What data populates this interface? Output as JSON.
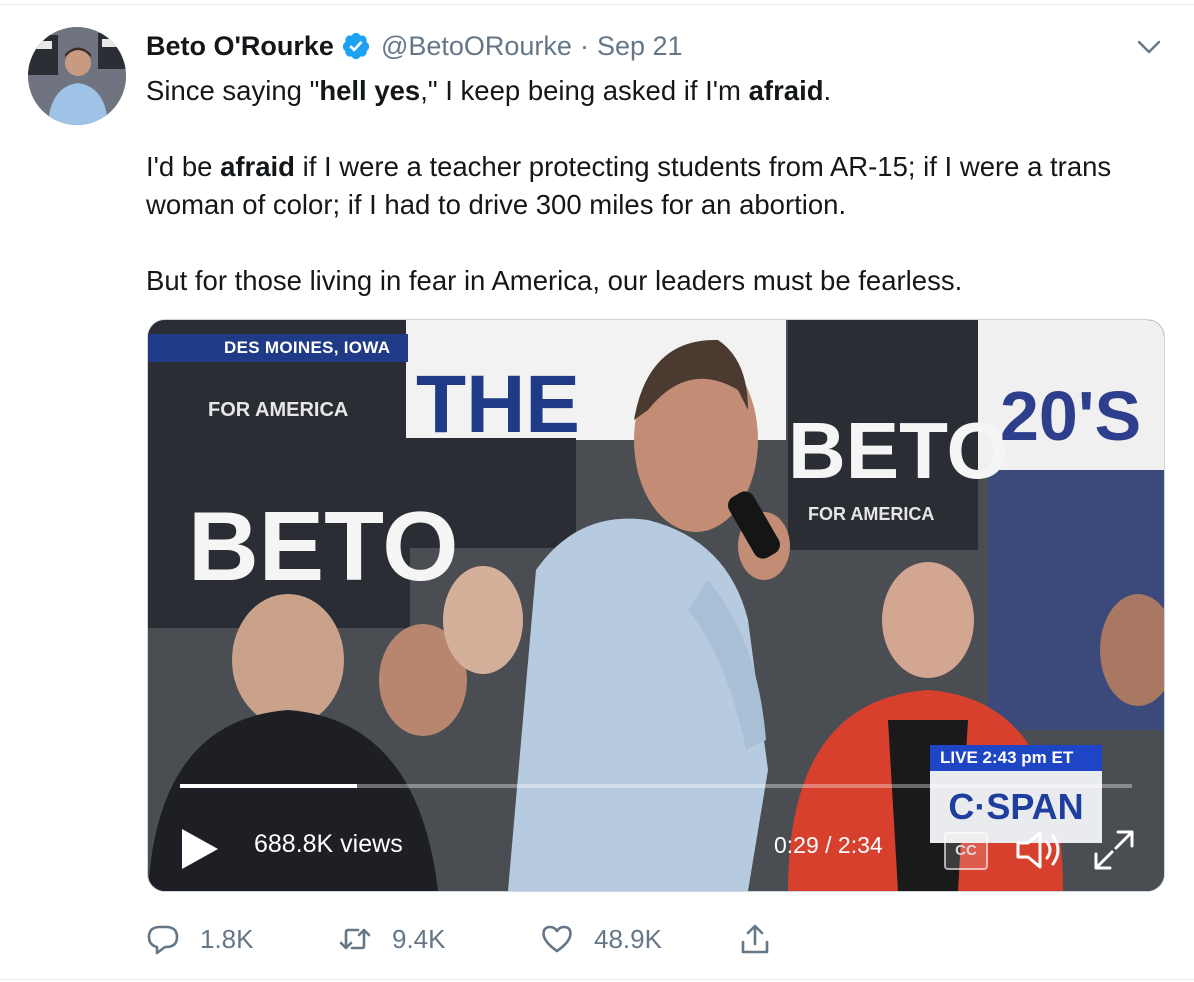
{
  "tweet": {
    "author_name": "Beto O'Rourke",
    "handle": "@BetoORourke",
    "separator": "·",
    "date": "Sep 21",
    "text_line1_pre": "Since saying \"",
    "text_line1_bold1": "hell yes",
    "text_line1_mid": ",\" I keep being asked if I'm ",
    "text_line1_bold2": "afraid",
    "text_line1_post": ".",
    "text_para2_pre": "I'd be ",
    "text_para2_bold": "afraid",
    "text_para2_post": " if I were a teacher protecting students from AR-15; if I were a trans woman of color; if I had to drive 300 miles for an abortion.",
    "text_para3": "But for those living in fear in America, our leaders must be fearless."
  },
  "video": {
    "location_badge": "DES MOINES, IOWA",
    "views": "688.8K views",
    "time": "0:29 / 2:34",
    "progress_fraction": 0.186,
    "cc_label": "CC",
    "live_label": "LIVE  2:43 pm ET",
    "network_label": "C·SPAN",
    "sign_beto": "BETO",
    "sign_for_america": "FOR AMERICA",
    "sign_the": "THE",
    "sign_20s": "20'S"
  },
  "actions": {
    "replies": "1.8K",
    "retweets": "9.4K",
    "likes": "48.9K"
  },
  "icons": [
    "verified-badge-icon",
    "chevron-down-icon",
    "play-icon",
    "volume-icon",
    "fullscreen-icon",
    "reply-icon",
    "retweet-icon",
    "like-icon",
    "share-icon"
  ],
  "colors": {
    "verified": "#1da1f2",
    "secondary_text": "#657786",
    "cspan_blue": "#1d45c6"
  }
}
